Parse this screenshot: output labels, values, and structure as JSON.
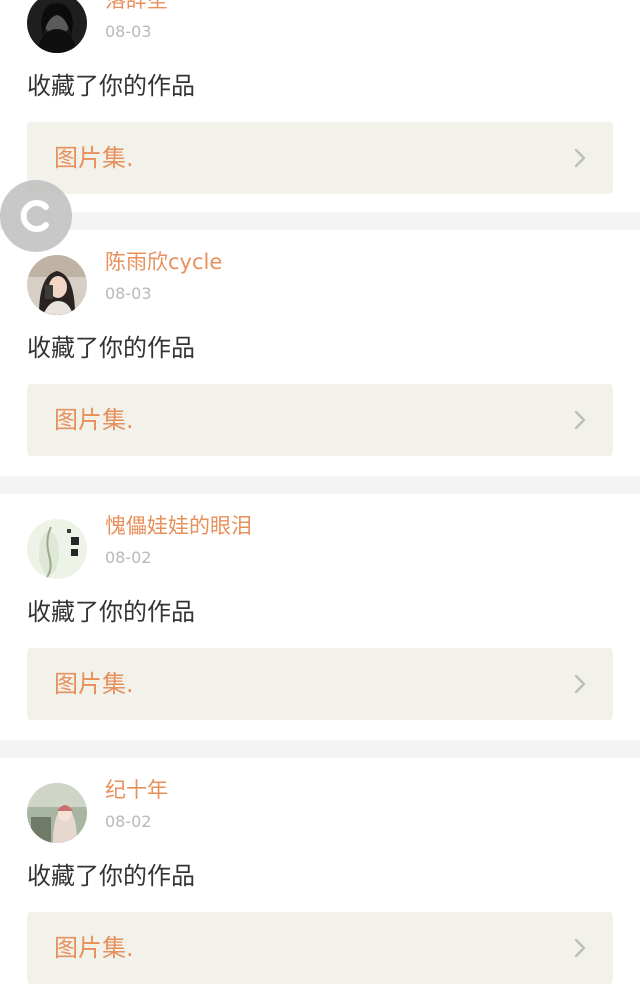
{
  "notifications": [
    {
      "username": "落辞笙",
      "date": "08-03",
      "action": "收藏了你的作品",
      "work_title": "图片集.",
      "avatar_icon": "avatar-dark-photo"
    },
    {
      "username": "陈雨欣cycle",
      "date": "08-03",
      "action": "收藏了你的作品",
      "work_title": "图片集.",
      "avatar_icon": "avatar-girl-photo"
    },
    {
      "username": "愧儡娃娃的眼泪",
      "date": "08-02",
      "action": "收藏了你的作品",
      "work_title": "图片集.",
      "avatar_icon": "avatar-calligraphy-photo"
    },
    {
      "username": "纪十年",
      "date": "08-02",
      "action": "收藏了你的作品",
      "work_title": "图片集.",
      "avatar_icon": "avatar-anime-photo"
    }
  ],
  "floating_badge": {
    "letter": "C"
  },
  "colors": {
    "accent": "#e8905c",
    "date_gray": "#b9b9b9",
    "text_dark": "#333333",
    "work_card_bg": "#f2f1ea",
    "separator": "#f4f4f4",
    "chevron": "#bdbdbd"
  }
}
